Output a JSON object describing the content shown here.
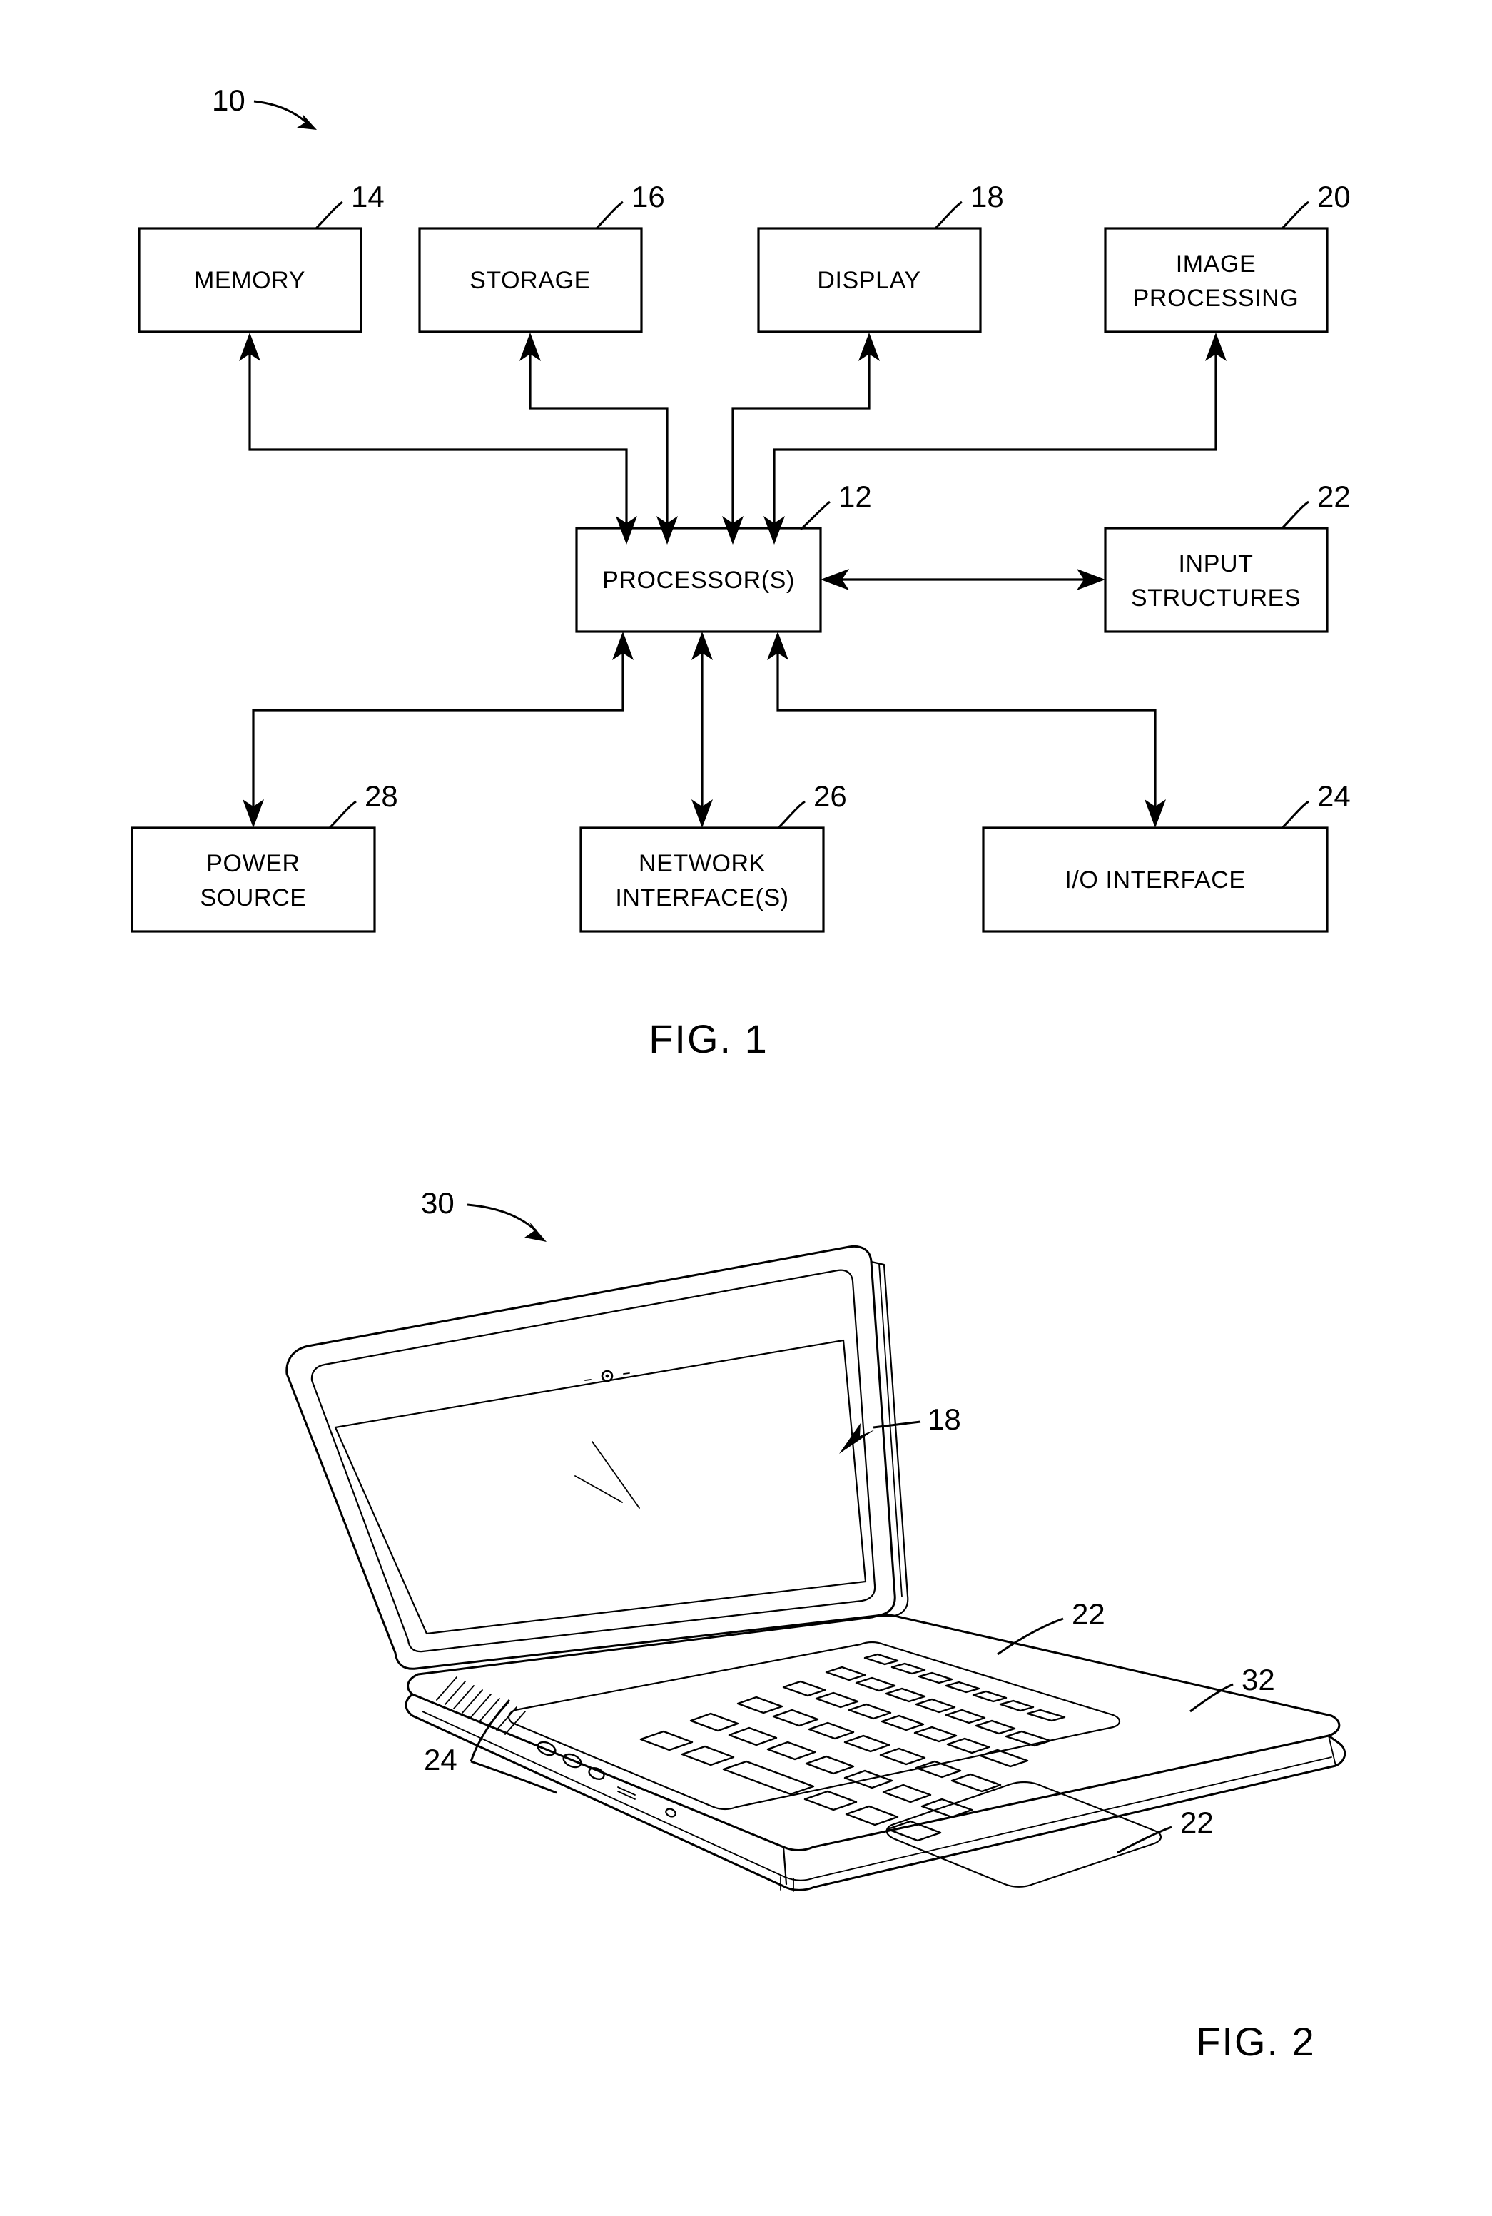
{
  "figure1": {
    "caption": "FIG. 1",
    "system_ref": "10",
    "blocks": [
      {
        "id": "memory",
        "label": "MEMORY",
        "label2": "",
        "ref": "14"
      },
      {
        "id": "storage",
        "label": "STORAGE",
        "label2": "",
        "ref": "16"
      },
      {
        "id": "display",
        "label": "DISPLAY",
        "label2": "",
        "ref": "18"
      },
      {
        "id": "image-processing",
        "label": "IMAGE",
        "label2": "PROCESSING",
        "ref": "20"
      },
      {
        "id": "processor",
        "label": "PROCESSOR(S)",
        "label2": "",
        "ref": "12"
      },
      {
        "id": "input-structures",
        "label": "INPUT",
        "label2": "STRUCTURES",
        "ref": "22"
      },
      {
        "id": "power-source",
        "label": "POWER",
        "label2": "SOURCE",
        "ref": "28"
      },
      {
        "id": "network-interface",
        "label": "NETWORK",
        "label2": "INTERFACE(S)",
        "ref": "26"
      },
      {
        "id": "io-interface",
        "label": "I/O INTERFACE",
        "label2": "",
        "ref": "24"
      }
    ]
  },
  "figure2": {
    "caption": "FIG. 2",
    "device_ref": "30",
    "callouts": [
      {
        "id": "display",
        "ref": "18"
      },
      {
        "id": "keyboard",
        "ref": "22"
      },
      {
        "id": "housing",
        "ref": "32"
      },
      {
        "id": "trackpad",
        "ref": "22"
      },
      {
        "id": "io-ports",
        "ref": "24"
      }
    ]
  },
  "colors": {
    "ink": "#000000",
    "paper": "#ffffff"
  }
}
